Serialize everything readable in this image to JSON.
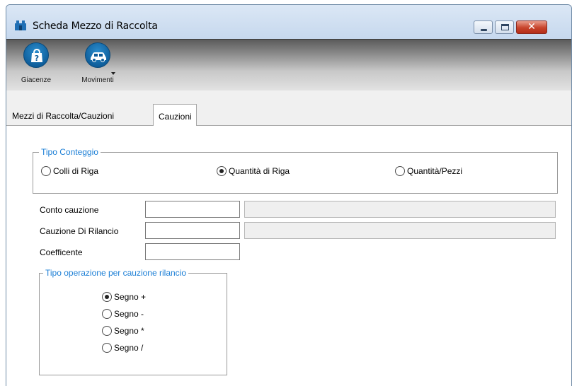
{
  "window": {
    "title": "Scheda Mezzo di Raccolta",
    "buttons": [
      "minimize",
      "maximize",
      "close"
    ],
    "close_glyph": "✕"
  },
  "toolbar": {
    "items": [
      {
        "label": "Giacenze",
        "icon": "package-question-icon"
      },
      {
        "label": "Movimenti",
        "icon": "car-icon",
        "has_dropdown": true
      }
    ]
  },
  "tabs": [
    {
      "label": "Mezzi di Raccolta/Cauzioni",
      "active": false
    },
    {
      "label": "Cauzioni",
      "active": true
    }
  ],
  "tipo_conteggio": {
    "legend": "Tipo Conteggio",
    "options": [
      {
        "label": "Colli di Riga",
        "checked": false
      },
      {
        "label": "Quantità di Riga",
        "checked": true
      },
      {
        "label": "Quantità/Pezzi",
        "checked": false
      }
    ]
  },
  "fields": {
    "conto_cauzione": {
      "label": "Conto cauzione",
      "value": "",
      "description": ""
    },
    "cauzione_rilancio": {
      "label": "Cauzione Di Rilancio",
      "value": "",
      "description": ""
    },
    "coefficente": {
      "label": "Coefficente",
      "value": ""
    }
  },
  "tipo_operazione": {
    "legend": "Tipo operazione per cauzione rilancio",
    "options": [
      {
        "label": "Segno +",
        "checked": true
      },
      {
        "label": "Segno -",
        "checked": false
      },
      {
        "label": "Segno *",
        "checked": false
      },
      {
        "label": "Segno /",
        "checked": false
      }
    ]
  },
  "colors": {
    "legend_text": "#1c7fd6",
    "toolbar_icon": "#0d5c99",
    "close_button": "#c7432b"
  }
}
